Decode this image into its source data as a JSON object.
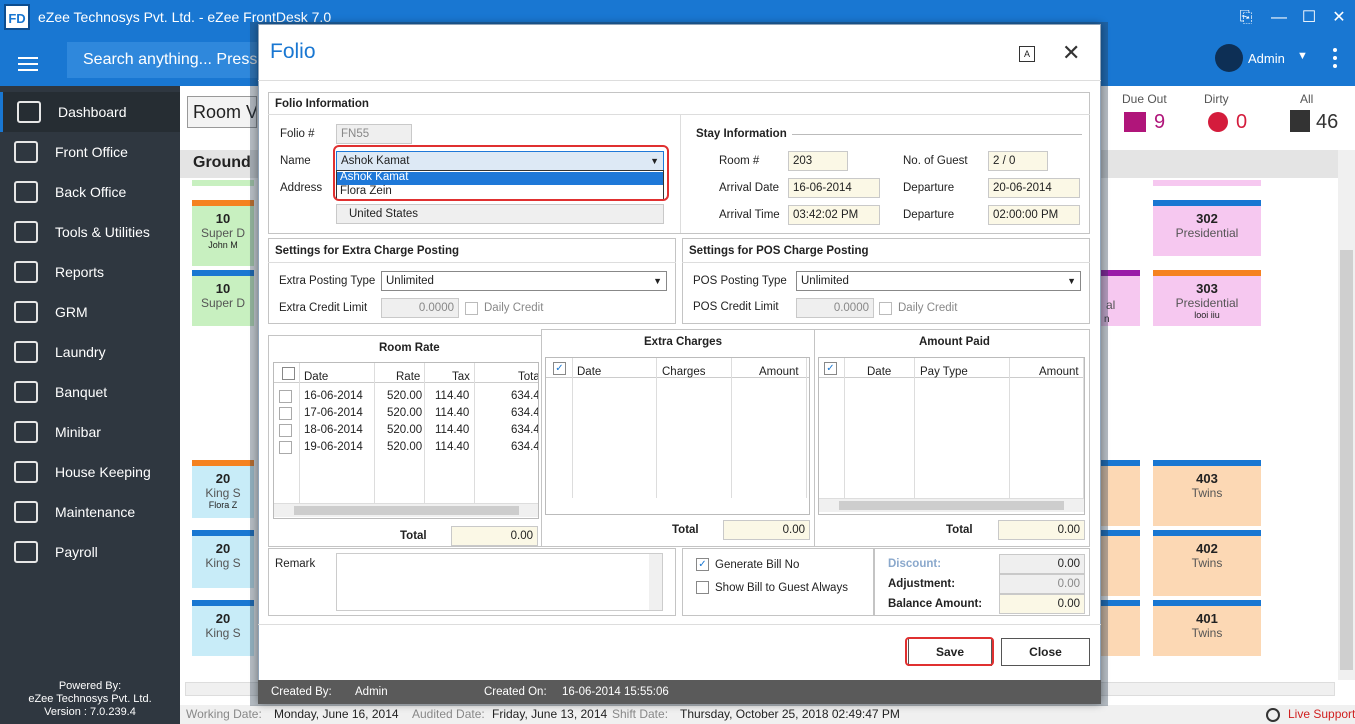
{
  "app": {
    "title": "eZee Technosys Pvt. Ltd. - eZee FrontDesk 7.0",
    "logo": "FD"
  },
  "topbar": {
    "search_placeholder": "Search anything... Press",
    "user": "Admin"
  },
  "sidebar": {
    "items": [
      {
        "label": "Dashboard",
        "icon": "dashboard-icon"
      },
      {
        "label": "Front Office",
        "icon": "front-office-icon"
      },
      {
        "label": "Back Office",
        "icon": "back-office-icon"
      },
      {
        "label": "Tools & Utilities",
        "icon": "tools-icon"
      },
      {
        "label": "Reports",
        "icon": "reports-icon"
      },
      {
        "label": "GRM",
        "icon": "grm-icon"
      },
      {
        "label": "Laundry",
        "icon": "laundry-icon"
      },
      {
        "label": "Banquet",
        "icon": "banquet-icon"
      },
      {
        "label": "Minibar",
        "icon": "minibar-icon"
      },
      {
        "label": "House Keeping",
        "icon": "housekeeping-icon"
      },
      {
        "label": "Maintenance",
        "icon": "maintenance-icon"
      },
      {
        "label": "Payroll",
        "icon": "payroll-icon"
      }
    ],
    "powered": [
      "Powered By:",
      "eZee Technosys Pvt. Ltd.",
      "Version : 7.0.239.4"
    ]
  },
  "roomview": {
    "view_button": "Room V",
    "floor_tab": "Ground",
    "stats": {
      "due_out_label": "Due Out",
      "due_out_value": "9",
      "dirty_label": "Dirty",
      "dirty_value": "0",
      "all_label": "All",
      "all_value": "46"
    },
    "left_cards": [
      {
        "num": "10",
        "type": "Super D",
        "guest": "John M"
      },
      {
        "num": "10",
        "type": "Super D",
        "guest": ""
      },
      {
        "num": "20",
        "type": "King S",
        "guest": "Flora Z"
      },
      {
        "num": "20",
        "type": "King S",
        "guest": ""
      },
      {
        "num": "20",
        "type": "King S",
        "guest": ""
      }
    ],
    "right_cards": [
      {
        "num": "302",
        "type": "Presidential",
        "guest": ""
      },
      {
        "num": "303",
        "type": "Presidential",
        "guest": "looi iiu"
      },
      {
        "num": "403",
        "type": "Twins",
        "guest": ""
      },
      {
        "num": "402",
        "type": "Twins",
        "guest": ""
      },
      {
        "num": "401",
        "type": "Twins",
        "guest": ""
      }
    ],
    "partial_card": {
      "type": "al",
      "guest": "n"
    }
  },
  "statusbar": {
    "working_label": "Working Date:",
    "working_value": "Monday, June 16, 2014",
    "audited_label": "Audited Date:",
    "audited_value": "Friday, June 13, 2014",
    "shift_label": "Shift Date:",
    "shift_value": "Thursday, October 25, 2018 02:49:47 PM",
    "support": "Live Support"
  },
  "folio": {
    "title": "Folio",
    "info_title": "Folio Information",
    "folio_no_label": "Folio #",
    "folio_no": "FN55",
    "name_label": "Name",
    "name_value": "Ashok Kamat",
    "name_options": [
      "Ashok Kamat",
      "Flora Zein"
    ],
    "address_label": "Address",
    "country": "United States",
    "stay_title": "Stay Information",
    "room_label": "Room #",
    "room": "203",
    "guests_label": "No. of Guest",
    "guests": "2 / 0",
    "arrival_date_label": "Arrival Date",
    "arrival_date": "16-06-2014",
    "departure_date_label": "Departure",
    "departure_date": "20-06-2014",
    "arrival_time_label": "Arrival Time",
    "arrival_time": "03:42:02 PM",
    "departure_time_label": "Departure",
    "departure_time": "02:00:00 PM",
    "extra_title": "Settings for Extra Charge Posting",
    "extra_type_label": "Extra Posting Type",
    "extra_type": "Unlimited",
    "extra_limit_label": "Extra Credit Limit",
    "extra_limit": "0.0000",
    "daily_credit": "Daily Credit",
    "pos_title": "Settings for POS Charge Posting",
    "pos_type_label": "POS Posting Type",
    "pos_type": "Unlimited",
    "pos_limit_label": "POS Credit Limit",
    "pos_limit": "0.0000",
    "room_rate": {
      "title": "Room Rate",
      "columns": [
        "Date",
        "Rate",
        "Tax",
        "Tota"
      ],
      "rows": [
        [
          "16-06-2014",
          "520.00",
          "114.40",
          "634.4"
        ],
        [
          "17-06-2014",
          "520.00",
          "114.40",
          "634.4"
        ],
        [
          "18-06-2014",
          "520.00",
          "114.40",
          "634.4"
        ],
        [
          "19-06-2014",
          "520.00",
          "114.40",
          "634.4"
        ]
      ],
      "total_label": "Total",
      "total": "0.00"
    },
    "extra_charges": {
      "title": "Extra Charges",
      "columns": [
        "Date",
        "Charges",
        "Amount"
      ],
      "total_label": "Total",
      "total": "0.00"
    },
    "amount_paid": {
      "title": "Amount Paid",
      "columns": [
        "Date",
        "Pay Type",
        "Amount"
      ],
      "total_label": "Total",
      "total": "0.00"
    },
    "remark_label": "Remark",
    "generate_bill": "Generate Bill No",
    "show_bill": "Show Bill to Guest Always",
    "discount_label": "Discount:",
    "discount": "0.00",
    "adjustment_label": "Adjustment:",
    "adjustment": "0.00",
    "balance_label": "Balance Amount:",
    "balance": "0.00",
    "save": "Save",
    "close": "Close",
    "created_by_label": "Created By:",
    "created_by": "Admin",
    "created_on_label": "Created On:",
    "created_on": "16-06-2014 15:55:06"
  },
  "colors": {
    "brand": "#1977d2",
    "sidebar": "#2f3740",
    "highlight_outline": "#e03030",
    "due_out": "#b0157a",
    "dirty": "#d41c3c"
  }
}
